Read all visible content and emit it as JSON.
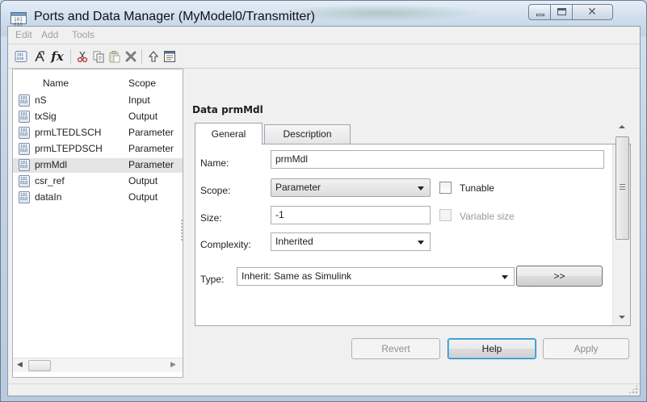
{
  "window": {
    "title": "Ports and Data Manager (MyModel0/Transmitter)",
    "close_glyph": "✕"
  },
  "menu": {
    "items": [
      "Edit",
      "Add",
      "Tools"
    ]
  },
  "toolbar": {
    "icons": [
      "add-data-icon",
      "add-parameter-icon",
      "function-icon",
      "cut-icon",
      "copy-icon",
      "paste-icon",
      "delete-icon",
      "move-up-icon",
      "property-sheet-icon"
    ],
    "fx_label": "fx"
  },
  "list": {
    "columns": {
      "name": "Name",
      "scope": "Scope"
    },
    "rows": [
      {
        "name": "nS",
        "scope": "Input"
      },
      {
        "name": "txSig",
        "scope": "Output"
      },
      {
        "name": "prmLTEDLSCH",
        "scope": "Parameter"
      },
      {
        "name": "prmLTEPDSCH",
        "scope": "Parameter"
      },
      {
        "name": "prmMdl",
        "scope": "Parameter",
        "selected": true
      },
      {
        "name": "csr_ref",
        "scope": "Output"
      },
      {
        "name": "dataIn",
        "scope": "Output"
      }
    ]
  },
  "detail": {
    "heading": "Data prmMdl",
    "tabs": [
      {
        "label": "General",
        "active": true
      },
      {
        "label": "Description",
        "active": false
      }
    ],
    "fields": {
      "name_label": "Name:",
      "name_value": "prmMdl",
      "scope_label": "Scope:",
      "scope_value": "Parameter",
      "tunable_label": "Tunable",
      "tunable_checked": false,
      "size_label": "Size:",
      "size_value": "-1",
      "variable_size_label": "Variable size",
      "variable_size_checked": false,
      "complexity_label": "Complexity:",
      "complexity_value": "Inherited",
      "type_label": "Type:",
      "type_value": "Inherit: Same as Simulink",
      "type_assistant_label": ">>"
    }
  },
  "buttons": {
    "revert": "Revert",
    "help": "Help",
    "apply": "Apply"
  }
}
